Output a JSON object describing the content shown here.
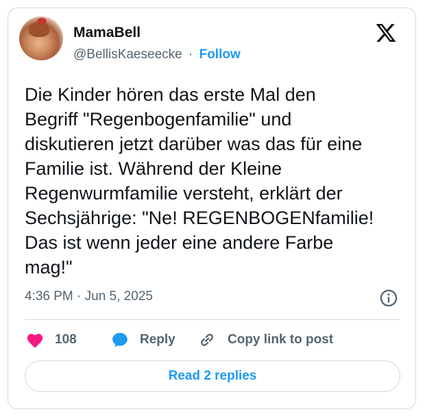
{
  "author": {
    "name": "MamaBell",
    "handle": "@BellisKaeseecke",
    "separator": "·",
    "follow_label": "Follow"
  },
  "tweet": {
    "text": "Die Kinder hören das erste Mal den\nBegriff \"Regenbogenfamilie\" und\ndiskutieren jetzt darüber was das für eine\nFamilie ist. Während der Kleine\nRegenwurmfamilie versteht, erklärt der\nSechsjährige: \"Ne! REGENBOGENfamilie!\nDas ist wenn jeder eine andere Farbe\nmag!\"",
    "timestamp": "4:36 PM · Jun 5, 2025"
  },
  "actions": {
    "like_count": "108",
    "reply_label": "Reply",
    "copy_label": "Copy link to post"
  },
  "replies_button_label": "Read 2 replies",
  "icons": {
    "logo": "x-logo-icon",
    "info": "info-icon",
    "like": "heart-icon",
    "reply": "speech-bubble-icon",
    "copy": "link-icon"
  },
  "colors": {
    "accent": "#1d9bf0",
    "like": "#f91880",
    "text": "#0f1419",
    "muted": "#536471",
    "border": "#cfd9de"
  }
}
